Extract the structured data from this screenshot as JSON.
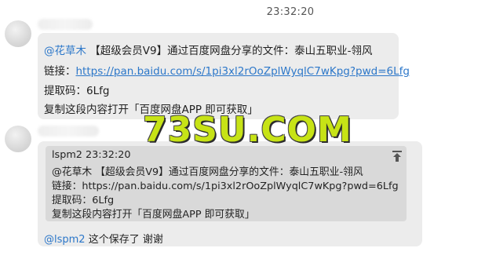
{
  "chat": {
    "timestamp": "23:32:20",
    "message1": {
      "mention": "@花草木",
      "line1_rest": " 【超级会员V9】通过百度网盘分享的文件：泰山五职业-翎风",
      "link_prefix": "链接：",
      "link_url": "https://pan.baidu.com/s/1pi3xl2rOoZplWyqlC7wKpg?pwd=6Lfg",
      "code_line": "提取码：6Lfg",
      "copy_line": "复制这段内容打开「百度网盘APP 即可获取」"
    },
    "message2": {
      "quote_header": "lspm2  23:32:20",
      "quote_line1": "@花草木 【超级会员V9】通过百度网盘分享的文件：泰山五职业-翎风",
      "quote_line2": "链接：https://pan.baidu.com/s/1pi3xl2rOoZplWyqlC7wKpg?pwd=6Lfg",
      "quote_line3": "提取码：6Lfg",
      "quote_line4": "复制这段内容打开「百度网盘APP 即可获取」",
      "reply_mention": "@lspm2",
      "reply_text": " 这个保存了 谢谢"
    },
    "watermark": "73SU.COM"
  },
  "colors": {
    "bubble": "#ececec",
    "quote": "#d9d9d9",
    "link": "#2c77c9",
    "watermark": "#c7e316"
  },
  "icons": [
    "scroll-to-quote-icon"
  ]
}
